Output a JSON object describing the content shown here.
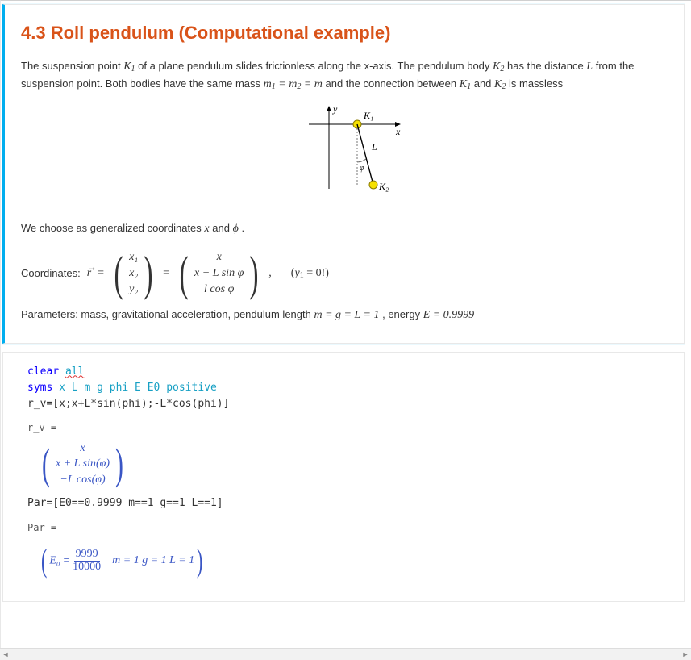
{
  "section": {
    "number": "4.3",
    "title": "Roll pendulum (Computational example)"
  },
  "para1": {
    "t1": "The suspension point ",
    "K1": "K",
    "K1s": "1",
    "t2": " of a plane pendulum slides frictionless along the x-axis. The pendulum body ",
    "K2": "K",
    "K2s": "2",
    "t3": " has the distance ",
    "L": "L",
    "t4": " from the suspension point. Both bodies have the same mass ",
    "massrel": "m₁ = m₂ = m",
    "t5": " and the connection between ",
    "K1b": "K",
    "K1bs": "1",
    "t6": " and ",
    "K2b": "K",
    "K2bs": "2",
    "t7": " is massless"
  },
  "diagram": {
    "ylab": "y",
    "xlab": "x",
    "K1": "K₁",
    "K2": "K₂",
    "L": "L",
    "phi": "φ"
  },
  "para2": {
    "t1": "We choose as generalized coordinates ",
    "x": "x",
    "t2": " and ",
    "phi": "ϕ",
    "t3": " ."
  },
  "coords": {
    "label": "Coordinates:",
    "r": "r",
    "eq": "=",
    "v1": {
      "a": "x₁",
      "b": "x₂",
      "c": "y₂"
    },
    "v2": {
      "a": "x",
      "b": "x + L sin φ",
      "c": "l cos φ"
    },
    "tail": ",",
    "note": "(y₁ = 0!)"
  },
  "params": {
    "t1": "Parameters: mass, gravitational acceleration, pendulum length ",
    "rel": "m = g = L = 1",
    "t2": ", energy ",
    "E": "E = 0.9999"
  },
  "code1": {
    "l1a": "clear ",
    "l1b": "all",
    "l2a": "syms ",
    "l2b": "x L m g phi E E0 positive",
    "l3": "r_v=[x;x+L*sin(phi);-L*cos(phi)]"
  },
  "out1": {
    "var": "r_v =",
    "a": "x",
    "b": "x + L sin(φ)",
    "c": "−L cos(φ)"
  },
  "code2": {
    "l1": "Par=[E0==0.9999 m==1 g==1 L==1]"
  },
  "out2": {
    "var": "Par =",
    "E0": "E₀",
    "eq": "=",
    "num": "9999",
    "den": "10000",
    "rest": "m = 1   g = 1   L = 1"
  }
}
